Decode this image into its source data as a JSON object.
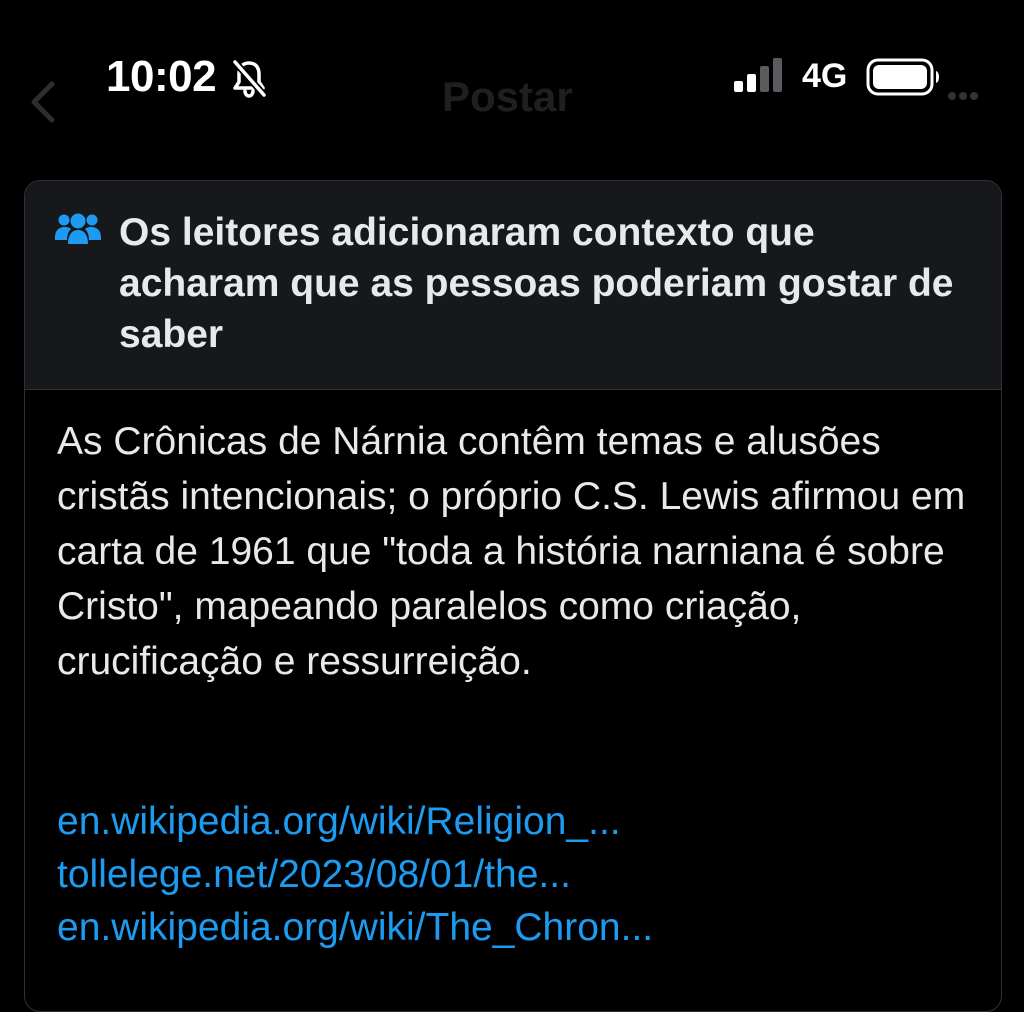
{
  "status_bar": {
    "time": "10:02",
    "network": "4G"
  },
  "header": {
    "title": "Postar"
  },
  "note": {
    "title": "Os leitores adicionaram contexto que acharam que as pessoas poderiam gostar de saber",
    "body": "As Crônicas de Nárnia contêm temas e alusões cristãs intencionais; o próprio C.S. Lewis afirmou em carta de 1961 que \"toda a história narniana é sobre Cristo\", mapeando paralelos como criação, crucificação e ressurreição.",
    "links": [
      "en.wikipedia.org/wiki/Religion_...",
      "tollelege.net/2023/08/01/the...",
      "en.wikipedia.org/wiki/The_Chron..."
    ]
  },
  "colors": {
    "background": "#000000",
    "card_header": "#16181c",
    "text": "#e7e9ea",
    "link": "#1d9bf0",
    "icon_accent": "#1d9bf0"
  }
}
